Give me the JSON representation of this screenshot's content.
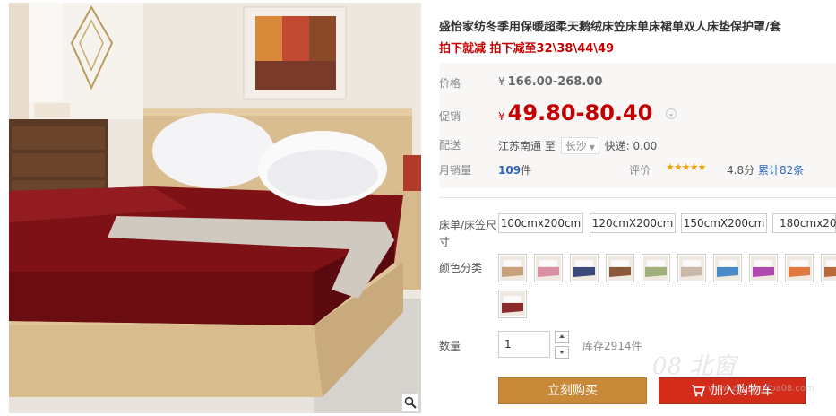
{
  "product": {
    "title": "盛怡家纺冬季用保暖超柔天鹅绒床笠床单床裙单双人床垫保护罩/套",
    "promo_line": "拍下就减 拍下减至32\\38\\44\\49"
  },
  "price": {
    "orig_label": "价格",
    "currency": "¥",
    "orig_value": "166.00-268.00",
    "promo_label": "促销",
    "promo_value": "49.80-80.40"
  },
  "shipping": {
    "label": "配送",
    "from": "江苏南通",
    "to_label": "至",
    "dest": "长沙",
    "fee_label": "快递: 0.00"
  },
  "sales": {
    "label": "月销量",
    "count": "109",
    "unit": "件",
    "review_label": "评价",
    "stars": "★★★★★",
    "score": "4.8分",
    "review_count": "累计82条"
  },
  "sizes": {
    "label": "床单/床笠尺寸",
    "options": [
      "100cmx200cm",
      "120cmX200cm",
      "150cmX200cm",
      "180cmx200cm"
    ]
  },
  "colors": {
    "label": "颜色分类",
    "swatches": [
      "#c8a27a",
      "#d98fa6",
      "#3a4a7a",
      "#8a5a3a",
      "#9fb07a",
      "#c9b8a8",
      "#4a8ac8",
      "#b04ab0",
      "#e07840",
      "#b86a3a",
      "#8a2a2a"
    ]
  },
  "quantity": {
    "label": "数量",
    "value": "1",
    "stock": "库存2914件"
  },
  "buttons": {
    "buy": "立刻购买",
    "cart": "加入购物车"
  },
  "watermark": {
    "text": "08 北窗",
    "sub": "www.zhuangjiba08.com"
  }
}
